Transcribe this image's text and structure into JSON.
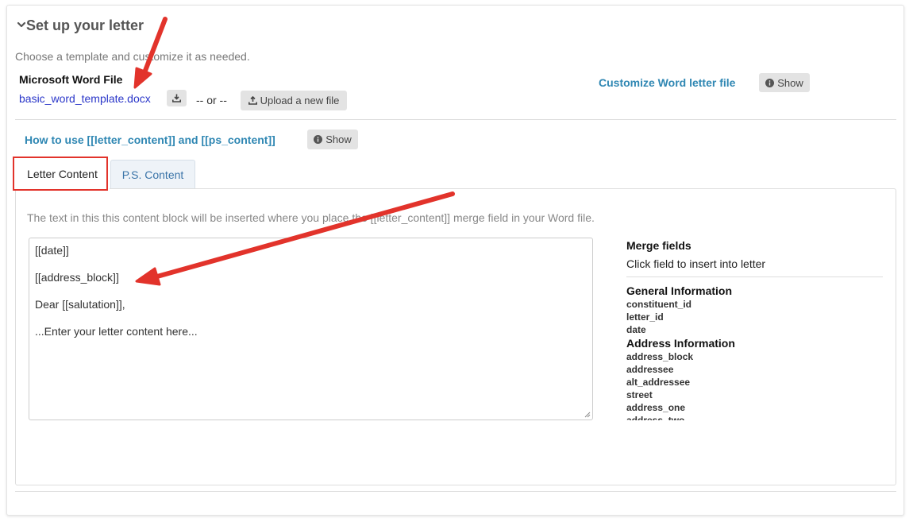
{
  "section": {
    "title": "Set up your letter",
    "intro": "Choose a template and customize it as needed."
  },
  "word_file": {
    "label": "Microsoft Word File",
    "filename": "basic_word_template.docx",
    "or_text": "-- or --",
    "upload_label": "Upload a new file"
  },
  "customize": {
    "link": "Customize Word letter file",
    "show_label": "Show"
  },
  "howto": {
    "link": "How to use [[letter_content]] and [[ps_content]]",
    "show_label": "Show"
  },
  "tabs": [
    {
      "label": "Letter Content",
      "active": true
    },
    {
      "label": "P.S. Content",
      "active": false
    }
  ],
  "panel": {
    "description": "The text in this this content block will be inserted where you place the [[letter_content]] merge field in your Word file.",
    "editor_lines": [
      "[[date]]",
      "[[address_block]]",
      "Dear [[salutation]],",
      "...Enter your letter content here..."
    ]
  },
  "merge_fields": {
    "title": "Merge fields",
    "hint": "Click field to insert into letter",
    "groups": [
      {
        "name": "General Information",
        "fields": [
          "constituent_id",
          "letter_id",
          "date"
        ]
      },
      {
        "name": "Address Information",
        "fields": [
          "address_block",
          "addressee",
          "alt_addressee",
          "street",
          "address_one",
          "address_two"
        ]
      }
    ]
  },
  "colors": {
    "link": "#2f87b3",
    "file_link": "#2a36c9",
    "annotation": "#e2332b"
  },
  "icons": [
    "chevron-down-icon",
    "download-icon",
    "upload-icon",
    "info-icon",
    "resize-grip-icon"
  ]
}
